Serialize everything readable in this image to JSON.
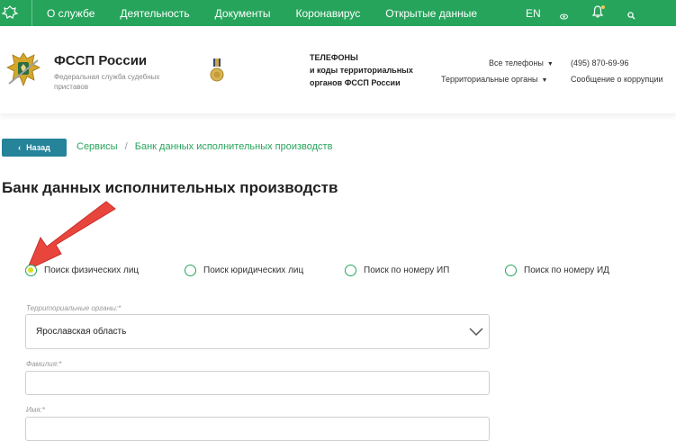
{
  "topbar": {
    "nav": [
      "О службе",
      "Деятельность",
      "Документы",
      "Коронавирус",
      "Открытые данные"
    ],
    "lang": "EN",
    "icons": [
      "emblem-icon",
      "eye-icon",
      "bell-icon",
      "search-icon"
    ],
    "bg_color": "#27a45c"
  },
  "header": {
    "org_title": "ФССП России",
    "org_subtitle": "Федеральная служба судебных приставов",
    "phones_title_lines": [
      "ТЕЛЕФОНЫ",
      "и коды территориальных",
      "органов ФССП России"
    ],
    "all_phones": "Все телефоны",
    "territorial": "Территориальные органы",
    "phone": "(495) 870-69-96",
    "corruption": "Сообщение о коррупции"
  },
  "breadcrumbs": {
    "back": "Назад",
    "items": [
      "Сервисы",
      "Банк данных исполнительных производств"
    ],
    "separator": "/"
  },
  "page": {
    "title": "Банк данных исполнительных производств"
  },
  "search_types": [
    {
      "label": "Поиск физических лиц",
      "checked": true
    },
    {
      "label": "Поиск юридических лиц",
      "checked": false
    },
    {
      "label": "Поиск по номеру ИП",
      "checked": false
    },
    {
      "label": "Поиск по номеру ИД",
      "checked": false
    }
  ],
  "form": {
    "territorial_label": "Территориальные органы:*",
    "territorial_value": "Ярославская область",
    "surname_label": "Фамилия:*",
    "surname_value": "",
    "name_label": "Имя:*",
    "name_value": ""
  },
  "colors": {
    "accent": "#27a45c",
    "back_button": "#25839a",
    "arrow": "#e8453c",
    "radio_dot": "#d8e020"
  }
}
